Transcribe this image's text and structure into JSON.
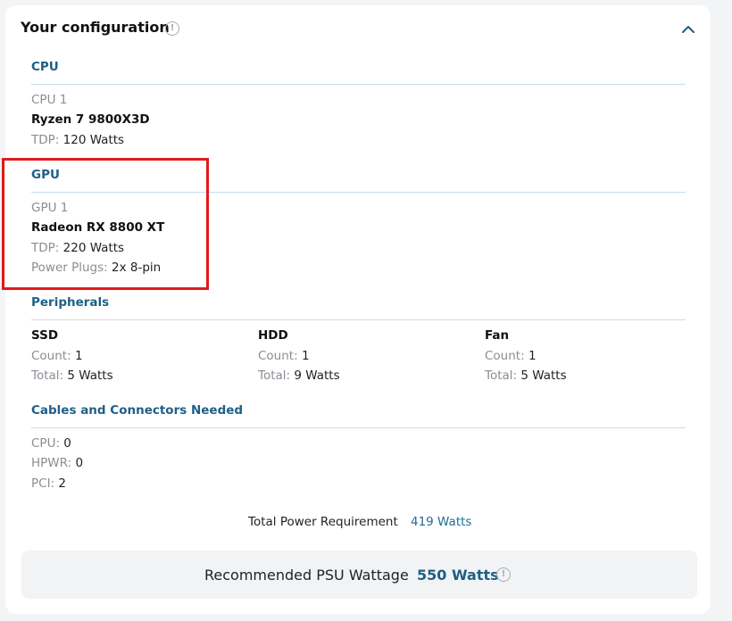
{
  "header": {
    "title": "Your configuration",
    "info_icon": "info-icon",
    "collapse_icon": "chevron-up-icon"
  },
  "cpu": {
    "section_title": "CPU",
    "item_label": "CPU 1",
    "model": "Ryzen 7 9800X3D",
    "tdp_label": "TDP:",
    "tdp_value": "120 Watts"
  },
  "gpu": {
    "section_title": "GPU",
    "item_label": "GPU 1",
    "model": "Radeon RX 8800 XT",
    "tdp_label": "TDP:",
    "tdp_value": "220 Watts",
    "plugs_label": "Power Plugs:",
    "plugs_value": "2x 8-pin"
  },
  "peripherals": {
    "section_title": "Peripherals",
    "items": [
      {
        "name": "SSD",
        "count_label": "Count:",
        "count": "1",
        "total_label": "Total:",
        "total": "5 Watts"
      },
      {
        "name": "HDD",
        "count_label": "Count:",
        "count": "1",
        "total_label": "Total:",
        "total": "9 Watts"
      },
      {
        "name": "Fan",
        "count_label": "Count:",
        "count": "1",
        "total_label": "Total:",
        "total": "5 Watts"
      }
    ]
  },
  "cables": {
    "section_title": "Cables and Connectors Needed",
    "items": [
      {
        "label": "CPU:",
        "value": "0"
      },
      {
        "label": "HPWR:",
        "value": "0"
      },
      {
        "label": "PCI:",
        "value": "2"
      }
    ]
  },
  "total": {
    "label": "Total Power Requirement",
    "value": "419 Watts"
  },
  "psu": {
    "label": "Recommended PSU Wattage",
    "value": "550 Watts",
    "info_icon": "info-icon"
  },
  "colors": {
    "accent": "#1e5f86",
    "highlight": "#e11b1b",
    "divider": "#c8dfeb"
  }
}
